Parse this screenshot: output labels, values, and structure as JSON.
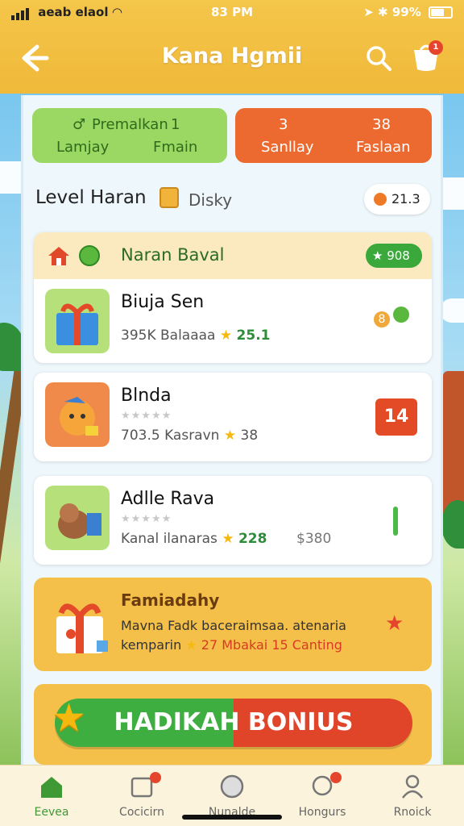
{
  "status_bar": {
    "carrier": "aeab elaol",
    "time": "83 PM",
    "battery": "99%"
  },
  "header": {
    "title": "Kana Hgmii",
    "cart_count": "1"
  },
  "stats": {
    "green": {
      "label": "Premalkan",
      "value": "1",
      "sub_left": "Lamjay",
      "sub_right": "Fmain"
    },
    "orange": {
      "value_left": "3",
      "value_right": "38",
      "sub_left": "Sanllay",
      "sub_right": "Faslaan"
    }
  },
  "level": {
    "title": "Level Haran",
    "subtitle": "Disky",
    "coins": "21.3"
  },
  "group": {
    "title": "Naran Baval",
    "score": "908"
  },
  "items": [
    {
      "name": "Biuja Sen",
      "meta": "395K Balaaaa",
      "rating": "25.1",
      "stars": "",
      "side": "8"
    },
    {
      "name": "Blnda",
      "meta": "703.5 Kasravn",
      "rating": "38",
      "stars": "★★★★★",
      "side": "14"
    },
    {
      "name": "Adlle Rava",
      "meta": "Kanal ilanaras",
      "rating": "228",
      "stars": "★★★★★",
      "extra": "$380"
    }
  ],
  "promo": {
    "title": "Famiadahy",
    "line1": "Mavna Fadk baceraimsaa. atenaria",
    "line2_prefix": "kemparin",
    "line2_highlight": "27 Mbakai 15 Canting"
  },
  "bonus": {
    "label": "HADIKAH BONIUS"
  },
  "tabs": [
    {
      "label": "Eevea",
      "icon": "home-icon"
    },
    {
      "label": "Cocicirn",
      "icon": "inbox-icon"
    },
    {
      "label": "Nunalde",
      "icon": "egg-icon"
    },
    {
      "label": "Hongurs",
      "icon": "chat-icon"
    },
    {
      "label": "Rnoick",
      "icon": "profile-icon"
    }
  ],
  "colors": {
    "header": "#f0b93a",
    "green": "#9bd863",
    "orange": "#ec6a2f",
    "accent_red": "#e24b26"
  }
}
